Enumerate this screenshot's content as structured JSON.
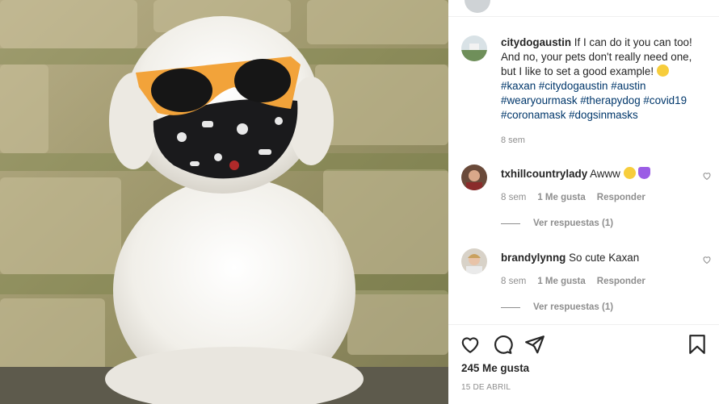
{
  "post": {
    "username": "citydogaustin",
    "caption_text": "If I can do it you can too! And no, your pets don't really need one, but I like to set a good example!",
    "hashtags_line1": "#kaxan #citydogaustin",
    "hashtags_line2": "#austin #wearyourmask #therapydog",
    "hashtags_line3": "#covid19 #coronamask #dogsinmasks",
    "time": "8 sem",
    "likes": "245 Me gusta",
    "date": "15 DE ABRIL"
  },
  "comments": [
    {
      "username": "txhillcountrylady",
      "text": "Awww",
      "time": "8 sem",
      "likes": "1 Me gusta",
      "reply": "Responder",
      "view_replies": "Ver respuestas (1)"
    },
    {
      "username": "brandylynng",
      "text": "So cute Kaxan",
      "time": "8 sem",
      "likes": "1 Me gusta",
      "reply": "Responder",
      "view_replies": "Ver respuestas (1)"
    }
  ],
  "icons": {
    "like": "heart-icon",
    "comment": "comment-icon",
    "share": "paper-plane-icon",
    "save": "bookmark-icon"
  },
  "colors": {
    "hashtag": "#00376b",
    "muted": "#8e8e8e",
    "text": "#262626",
    "sunglasses": "#f2a33a"
  }
}
